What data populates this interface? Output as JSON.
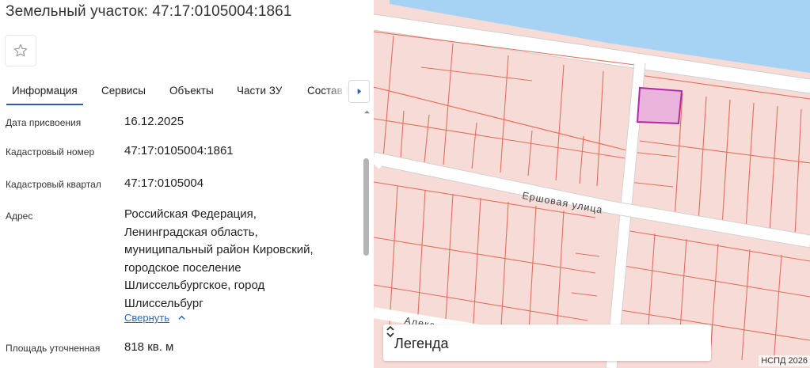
{
  "header": {
    "title": "Земельный участок: 47:17:0105004:1861"
  },
  "tabs": [
    {
      "label": "Информация",
      "active": true
    },
    {
      "label": "Сервисы",
      "active": false
    },
    {
      "label": "Объекты",
      "active": false
    },
    {
      "label": "Части ЗУ",
      "active": false
    },
    {
      "label": "Состав ЕЗП",
      "active": false
    }
  ],
  "info": {
    "assignment_date": {
      "label": "Дата присвоения",
      "value": "16.12.2025"
    },
    "cadastral_number": {
      "label": "Кадастровый номер",
      "value": "47:17:0105004:1861"
    },
    "cadastral_quarter": {
      "label": "Кадастровый квартал",
      "value": "47:17:0105004"
    },
    "address": {
      "label": "Адрес",
      "lines": [
        "Российская Федерация,",
        "Ленинградская область,",
        "муниципальный район Кировский,",
        "городское поселение",
        "Шлиссельбургское, город",
        "Шлиссельбург"
      ],
      "collapse_label": "Свернуть"
    },
    "area": {
      "label": "Площадь уточненная",
      "value": "818 кв. м"
    }
  },
  "map": {
    "street_1": "Ершовая улица",
    "street_2": "Алекс",
    "legend_title": "Легенда",
    "attribution": "НСПД 2026",
    "colors": {
      "background": "#f7dbd6",
      "parcel_border": "#e0705c",
      "road": "#ffffff",
      "water": "#a6d3f3",
      "selected_fill": "#e9b3dc",
      "selected_border": "#b02aa6"
    }
  },
  "icons": {
    "favorite": "star-outline-icon",
    "tabs_scroll": "caret-right-icon",
    "collapse": "chevron-up-icon",
    "legend_toggle": "unfold-icon"
  }
}
